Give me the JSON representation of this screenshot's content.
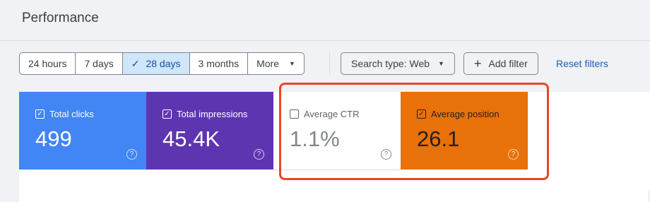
{
  "header": {
    "title": "Performance"
  },
  "date_range": {
    "options": [
      {
        "label": "24 hours",
        "selected": false
      },
      {
        "label": "7 days",
        "selected": false
      },
      {
        "label": "28 days",
        "selected": true
      },
      {
        "label": "3 months",
        "selected": false
      },
      {
        "label": "More",
        "selected": false
      }
    ]
  },
  "filters": {
    "search_type_label": "Search type: Web",
    "add_filter_label": "Add filter",
    "reset_label": "Reset filters"
  },
  "metrics": [
    {
      "label": "Total clicks",
      "value": "499",
      "checked": true,
      "color": "#4285f4"
    },
    {
      "label": "Total impressions",
      "value": "45.4K",
      "checked": true,
      "color": "#5e35b1"
    },
    {
      "label": "Average CTR",
      "value": "1.1%",
      "checked": false,
      "color": "#ffffff"
    },
    {
      "label": "Average position",
      "value": "26.1",
      "checked": true,
      "color": "#e8710a"
    }
  ],
  "icons": {
    "check": "✓",
    "caret": "▼",
    "plus": "+",
    "help": "?"
  },
  "highlight_color": "#e8472a"
}
